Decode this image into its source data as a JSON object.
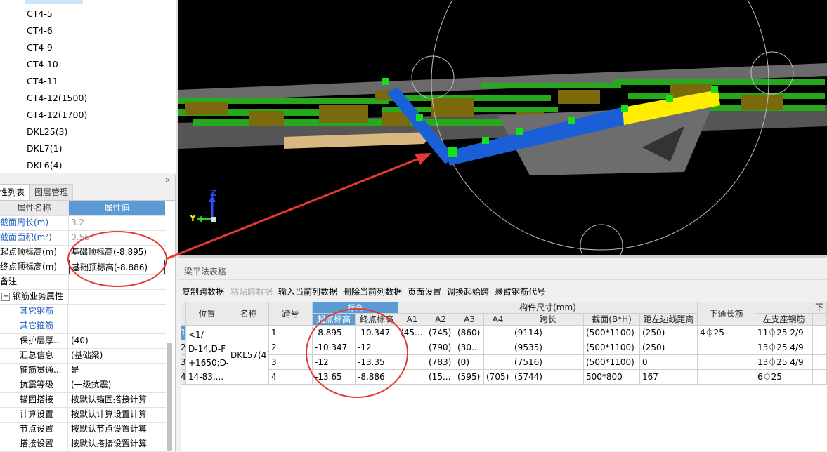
{
  "tree": {
    "items": [
      "CT4-5",
      "CT4-6",
      "CT4-9",
      "CT4-10",
      "CT4-11",
      "CT4-12(1500)",
      "CT4-12(1700)",
      "DKL25(3)",
      "DKL7(1)",
      "DKL6(4)"
    ]
  },
  "panel": {
    "tabs": [
      "性列表",
      "图层管理"
    ],
    "close_glyph": "×",
    "header": {
      "name": "属性名称",
      "value": "属性值"
    },
    "rows": [
      {
        "name": "截面周长(m)",
        "value": "3.2"
      },
      {
        "name": "截面面积(m²)",
        "value": "0.55"
      },
      {
        "name": "起点顶标高(m)",
        "value": "基础顶标高(-8.895)"
      },
      {
        "name": "终点顶标高(m)",
        "value": "基础顶标高(-8.886)"
      },
      {
        "name": "备注",
        "value": ""
      },
      {
        "name": "钢筋业务属性",
        "value": "",
        "expander": "−"
      },
      {
        "name": "其它钢筋",
        "value": ""
      },
      {
        "name": "其它箍筋",
        "value": ""
      },
      {
        "name": "保护层厚...",
        "value": "(40)"
      },
      {
        "name": "汇总信息",
        "value": "(基础梁)"
      },
      {
        "name": "箍筋贯通...",
        "value": "是"
      },
      {
        "name": "抗震等级",
        "value": "(一级抗震)"
      },
      {
        "name": "锚固搭接",
        "value": "按默认锚固搭接计算"
      },
      {
        "name": "计算设置",
        "value": "按默认计算设置计算"
      },
      {
        "name": "节点设置",
        "value": "按默认节点设置计算"
      },
      {
        "name": "搭接设置",
        "value": "按默认搭接设置计算"
      }
    ]
  },
  "view3d": {
    "axis_z": "Z",
    "axis_y": "Y"
  },
  "beam_table": {
    "title": "梁平法表格",
    "toolbar": [
      "复制跨数据",
      "粘贴跨数据",
      "输入当前列数据",
      "删除当前列数据",
      "页面设置",
      "调换起始跨",
      "悬臂钢筋代号"
    ],
    "headers": {
      "position": "位置",
      "name": "名称",
      "span_no": "跨号",
      "elevation": "标高",
      "start_elev": "起点标高",
      "end_elev": "终点标高",
      "member_size": "构件尺寸(mm)",
      "a1": "A1",
      "a2": "A2",
      "a3": "A3",
      "a4": "A4",
      "span_len": "跨长",
      "section": "截面(B*H)",
      "edge_dist": "距左边线距离",
      "bottom_rebar": "下通长筋",
      "left_support": "左支座钢筋",
      "more": "下"
    },
    "position_text": "<1/\nD-14,D-F\n+1650;D-\n14-83,...",
    "name_text": "DKL57(4)",
    "rows": [
      {
        "num": "1",
        "span": "1",
        "start": "-8.895",
        "end": "-10.347",
        "a1": "(45...",
        "a2": "(745)",
        "a3": "(860)",
        "a4": "",
        "len": "(9114)",
        "sec": "(500*1100)",
        "dist": "(250)",
        "bottom": "4⏀25",
        "left": "11⏀25 2/9"
      },
      {
        "num": "2",
        "span": "2",
        "start": "-10.347",
        "end": "-12",
        "a1": "",
        "a2": "(790)",
        "a3": "(30...",
        "a4": "",
        "len": "(9535)",
        "sec": "(500*1100)",
        "dist": "(250)",
        "bottom": "",
        "left": "13⏀25 4/9"
      },
      {
        "num": "3",
        "span": "3",
        "start": "-12",
        "end": "-13.35",
        "a1": "",
        "a2": "(783)",
        "a3": "(0)",
        "a4": "",
        "len": "(7516)",
        "sec": "(500*1100)",
        "dist": "0",
        "bottom": "",
        "left": "13⏀25 4/9"
      },
      {
        "num": "4",
        "span": "4",
        "start": "-13.65",
        "end": "-8.886",
        "a1": "",
        "a2": "(15...",
        "a3": "(595)",
        "a4": "(705)",
        "len": "(5744)",
        "sec": "500*800",
        "dist": "167",
        "bottom": "",
        "left": "6⏀25"
      }
    ]
  },
  "colors": {
    "accent": "#5b9bd5",
    "annotation": "#e53935",
    "beam_blue": "#1b5fd6",
    "beam_yellow": "#ffee00",
    "node_green": "#18e018"
  }
}
